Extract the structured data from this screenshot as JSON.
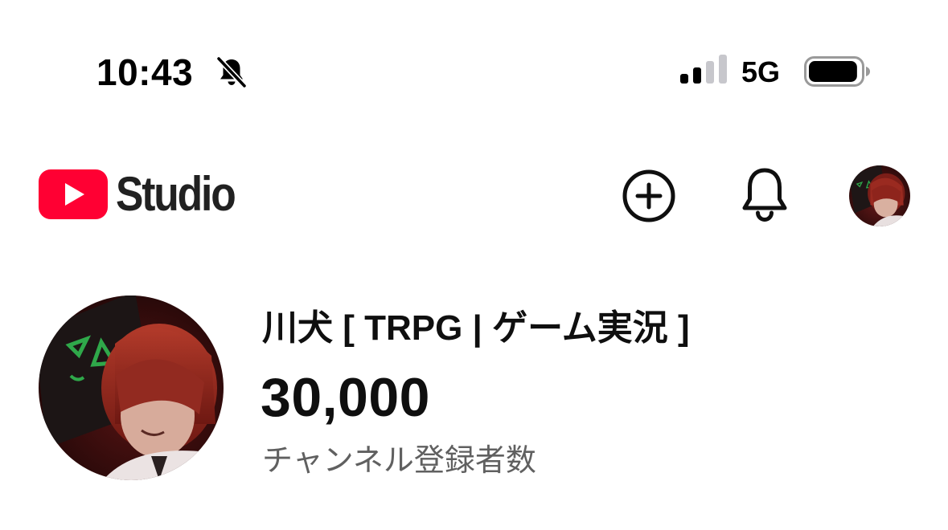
{
  "status_bar": {
    "time": "10:43",
    "network": "5G",
    "signal_bars_active": 2,
    "signal_bars_total": 4,
    "battery_level": 0.95,
    "icons": [
      "bell-slash-icon",
      "cellular-signal-icon",
      "battery-icon"
    ]
  },
  "header": {
    "logo_text": "Studio",
    "brand_color": "#ff0033",
    "icons": [
      "youtube-play-icon",
      "add-circle-icon",
      "bell-icon",
      "account-avatar"
    ]
  },
  "channel": {
    "name": "川犬 [ TRPG | ゲーム実況 ]",
    "subscriber_count": "30,000",
    "subscriber_label": "チャンネル登録者数",
    "secondary_text_color": "#606060"
  }
}
